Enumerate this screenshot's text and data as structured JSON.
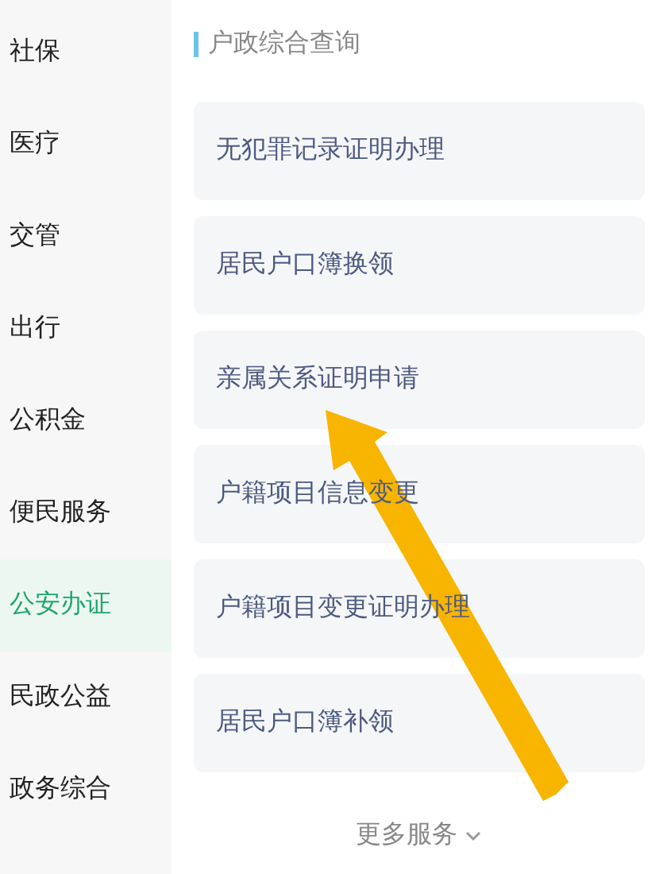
{
  "sidebar": {
    "items": [
      {
        "label": "社保",
        "selected": false
      },
      {
        "label": "医疗",
        "selected": false
      },
      {
        "label": "交管",
        "selected": false
      },
      {
        "label": "出行",
        "selected": false
      },
      {
        "label": "公积金",
        "selected": false
      },
      {
        "label": "便民服务",
        "selected": false
      },
      {
        "label": "公安办证",
        "selected": true
      },
      {
        "label": "民政公益",
        "selected": false
      },
      {
        "label": "政务综合",
        "selected": false
      }
    ]
  },
  "section": {
    "title": "户政综合查询",
    "items": [
      {
        "label": "无犯罪记录证明办理"
      },
      {
        "label": "居民户口簿换领"
      },
      {
        "label": "亲属关系证明申请"
      },
      {
        "label": "户籍项目信息变更"
      },
      {
        "label": "户籍项目变更证明办理"
      },
      {
        "label": "居民户口簿补领"
      }
    ]
  },
  "more": {
    "label": "更多服务"
  }
}
